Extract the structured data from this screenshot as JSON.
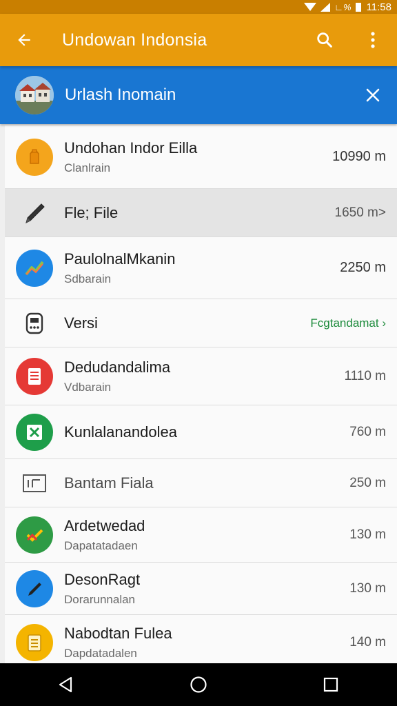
{
  "status_bar": {
    "signal_text": "∟%",
    "time": "11:58"
  },
  "app_bar": {
    "title": "Undowan Indonsia",
    "icons": [
      "back-arrow-icon",
      "search-icon",
      "more-vert-icon"
    ]
  },
  "banner": {
    "title": "Urlash Inomain",
    "icons": [
      "close-icon"
    ]
  },
  "colors": {
    "app_bar": "#e89b0c",
    "banner": "#1976d2",
    "accent_green": "#1b8a3a"
  },
  "list": {
    "items": [
      {
        "title": "Undohan Indor Eilla",
        "subtitle": "Clanlrain",
        "meta": "10990 m",
        "icon": "orange-bag-icon"
      },
      {
        "title": "Fle; File",
        "subtitle": "",
        "meta": "1650 m>",
        "icon": "pen-icon"
      },
      {
        "title": "PaulolnalMkanin",
        "subtitle": "Sdbarain",
        "meta": "2250 m",
        "icon": "chart-icon"
      },
      {
        "title": "Versi",
        "subtitle": "",
        "meta": "Fcgtandamat ›",
        "icon": "device-icon"
      },
      {
        "title": "Dedudandalima",
        "subtitle": "Vdbarain",
        "meta": "1110 m",
        "icon": "red-document-icon"
      },
      {
        "title": "Kunlalanandolea",
        "subtitle": "",
        "meta": "760 m",
        "icon": "excel-icon"
      },
      {
        "title": "Bantam Fiala",
        "subtitle": "",
        "meta": "250 m",
        "icon": "file-outline-icon"
      },
      {
        "title": "Ardetwedad",
        "subtitle": "Dapatatadaen",
        "meta": "130 m",
        "icon": "green-check-icon"
      },
      {
        "title": "DesonRagt",
        "subtitle": "Dorarunnalan",
        "meta": "130 m",
        "icon": "blue-pen-icon"
      },
      {
        "title": "Nabodtan Fulea",
        "subtitle": "Dapdatadalen",
        "meta": "140 m",
        "icon": "yellow-note-icon"
      }
    ]
  },
  "nav": {
    "icons": [
      "back-triangle-icon",
      "home-circle-icon",
      "recents-square-icon"
    ]
  }
}
